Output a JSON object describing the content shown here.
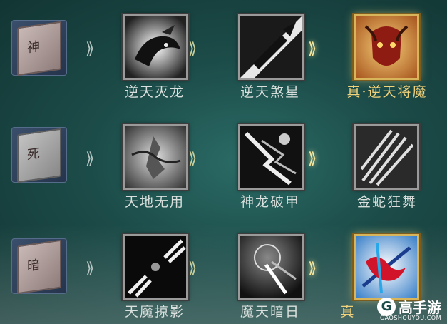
{
  "rows": [
    {
      "book": {
        "glyph": "神"
      },
      "skills": [
        {
          "name": "逆天灭龙",
          "icon": "dragon-skill-icon"
        },
        {
          "name": "逆天煞星",
          "icon": "sword-strike-icon"
        },
        {
          "name": "真·逆天将魔",
          "icon": "demon-mask-icon"
        }
      ]
    },
    {
      "book": {
        "glyph": "死"
      },
      "skills": [
        {
          "name": "天地无用",
          "icon": "warrior-figure-icon"
        },
        {
          "name": "神龙破甲",
          "icon": "dragon-armor-icon"
        },
        {
          "name": "金蛇狂舞",
          "icon": "serpent-blades-icon"
        }
      ]
    },
    {
      "book": {
        "glyph": "暗"
      },
      "skills": [
        {
          "name": "天魔掠影",
          "icon": "shadow-strike-icon"
        },
        {
          "name": "魔天暗日",
          "icon": "dark-sun-icon"
        },
        {
          "name": "真",
          "icon": "blood-slash-icon"
        }
      ]
    }
  ],
  "arrow_glyph": "⟫",
  "watermark": {
    "logo": "G",
    "title": "高手游",
    "subtitle": "GAOSHOUYOU.COM"
  },
  "colors": {
    "gold": "#f2d27a",
    "label": "#d9dfdc",
    "bg": "#1c4c49"
  }
}
